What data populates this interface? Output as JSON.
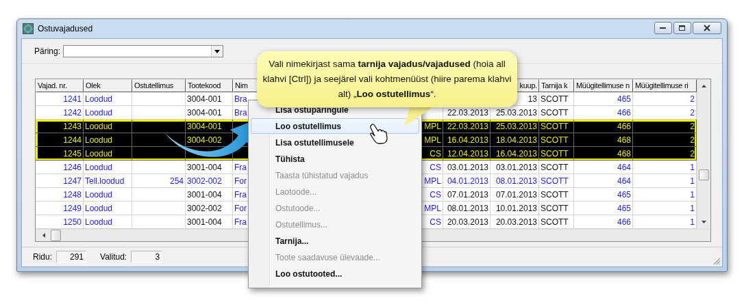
{
  "window": {
    "title": "Ostuvajadused"
  },
  "query": {
    "label": "Päring:"
  },
  "table": {
    "headers": {
      "nr": "Vajad. nr.",
      "olek": "Olek",
      "ostutellimus": "Ostutellimus",
      "tootekood": "Tootekood",
      "column_5": "Nim",
      "column_8": "kuup.",
      "tarnija": "Tarnija k",
      "myygi_nr": "Müügitellimuse n",
      "myygi_rida": "Müügitellimuse ri"
    },
    "rows": [
      {
        "selected": false,
        "highlighted": false,
        "nr": "1241",
        "olek": "Loodud",
        "tootekood": "3004-001",
        "column_5": "Bra",
        "column_8": "13",
        "tarnija": "SCOTT",
        "myygi_nr": "465",
        "myygi_rida": "2"
      },
      {
        "selected": false,
        "highlighted": false,
        "nr": "1242",
        "olek": "Loodud",
        "tootekood": "3004-001",
        "column_5": "Bra",
        "column_7": "22.03.2013",
        "column_8": "25.03.2013",
        "tarnija": "SCOTT",
        "myygi_nr": "466",
        "myygi_rida": "2"
      },
      {
        "selected": true,
        "highlighted": false,
        "nr": "1243",
        "olek": "Loodud",
        "tootekood": "3004-001",
        "column_6": "MPL",
        "column_7": "22.03.2013",
        "column_8": "25.03.2013",
        "tarnija": "SCOTT",
        "myygi_nr": "466",
        "myygi_rida": "2"
      },
      {
        "selected": true,
        "highlighted": false,
        "nr": "1244",
        "olek": "Loodud",
        "tootekood": "3004-002",
        "column_6": "MPL",
        "column_7": "16.04.2013",
        "column_8": "18.04.2013",
        "tarnija": "SCOTT",
        "myygi_nr": "468",
        "myygi_rida": "2"
      },
      {
        "selected": true,
        "highlighted": false,
        "nr": "1245",
        "olek": "Loodud",
        "column_6": "CS",
        "column_7": "12.04.2013",
        "column_8": "16.04.2013",
        "tarnija": "SCOTT",
        "myygi_nr": "468",
        "myygi_rida": "2"
      },
      {
        "selected": false,
        "highlighted": false,
        "nr": "1246",
        "olek": "Loodud",
        "tootekood": "3001-004",
        "column_5": "Fra",
        "column_6": "CS",
        "column_7": "03.01.2013",
        "column_8": "03.01.2013",
        "tarnija": "SCOTT",
        "myygi_nr": "464",
        "myygi_rida": "1"
      },
      {
        "selected": false,
        "highlighted": true,
        "nr": "1247",
        "olek": "Tell.loodud",
        "ostutellimus": "254",
        "tootekood": "3002-002",
        "column_5": "For",
        "column_6": "MPL",
        "column_7": "04.01.2013",
        "column_8": "08.01.2013",
        "tarnija": "SCOTT",
        "myygi_nr": "464",
        "myygi_rida": "1"
      },
      {
        "selected": false,
        "highlighted": false,
        "nr": "1248",
        "olek": "Loodud",
        "tootekood": "3001-004",
        "column_5": "Fra",
        "column_6": "CS",
        "column_7": "07.01.2013",
        "column_8": "07.01.2013",
        "tarnija": "SCOTT",
        "myygi_nr": "465",
        "myygi_rida": "1"
      },
      {
        "selected": false,
        "highlighted": false,
        "nr": "1249",
        "olek": "Loodud",
        "tootekood": "3002-002",
        "column_5": "For",
        "column_6": "MPL",
        "column_7": "08.01.2013",
        "column_8": "10.01.2013",
        "tarnija": "SCOTT",
        "myygi_nr": "465",
        "myygi_rida": "1"
      },
      {
        "selected": false,
        "highlighted": false,
        "nr": "1250",
        "olek": "Loodud",
        "tootekood": "3001-004",
        "column_5": "Fra",
        "column_6": "CS",
        "column_7": "20.03.2013",
        "column_8": "20.03.2013",
        "tarnija": "SCOTT",
        "myygi_nr": "466",
        "myygi_rida": "1"
      }
    ]
  },
  "status_bar": {
    "rows_label": "Ridu:",
    "rows_value": "291",
    "selected_label": "Valitud:",
    "selected_value": "3"
  },
  "context_menu": {
    "items": [
      {
        "label": "Lisa ostupäringule",
        "disabled": false,
        "selected": false
      },
      {
        "label": "Loo ostutellimus",
        "disabled": false,
        "selected": true
      },
      {
        "label": "Lisa ostutellimusele",
        "disabled": false,
        "selected": false
      },
      {
        "label": "Tühista",
        "disabled": false,
        "selected": false
      },
      {
        "label": "Taasta tühistatud vajadus",
        "disabled": true,
        "selected": false
      },
      {
        "label": "Laotoode...",
        "disabled": true,
        "selected": false
      },
      {
        "label": "Ostutoode...",
        "disabled": true,
        "selected": false
      },
      {
        "label": "Ostutellimus...",
        "disabled": true,
        "selected": false
      },
      {
        "label": "Tarnija...",
        "disabled": false,
        "selected": false
      },
      {
        "label": "Toote saadavuse ülevaade...",
        "disabled": true,
        "selected": false
      },
      {
        "label": "Loo ostutooted...",
        "disabled": false,
        "selected": false
      }
    ]
  },
  "callout": {
    "text": "Vali nimekirjast sama **tarnija vajadus/vajadused** (hoia all klahvi [Ctrl]) ja seejärel vali kohtmenüüst (hiire parema klahvi alt) „**Loo ostutellimus**“."
  }
}
